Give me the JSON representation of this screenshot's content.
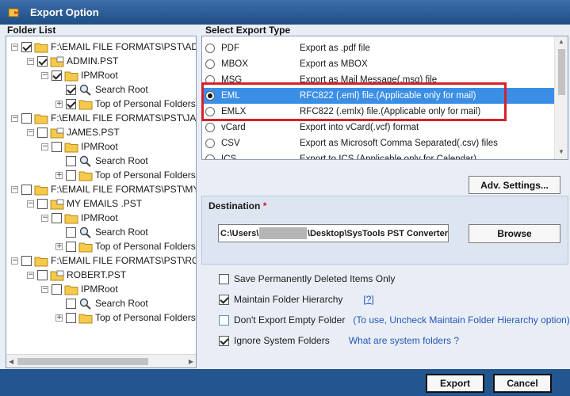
{
  "window": {
    "title": "Export Option"
  },
  "folder_list": {
    "label": "Folder List",
    "nodes": [
      {
        "label": "F:\\EMAIL FILE FORMATS\\PST\\ADM",
        "checked": true,
        "level": 0
      },
      {
        "label": "ADMIN.PST",
        "checked": true,
        "level": 1
      },
      {
        "label": "IPMRoot",
        "checked": true,
        "level": 2
      },
      {
        "label": "Search Root",
        "checked": true,
        "level": 3
      },
      {
        "label": "Top of Personal Folders",
        "checked": true,
        "level": 3
      },
      {
        "label": "F:\\EMAIL FILE FORMATS\\PST\\JAME",
        "checked": false,
        "level": 0
      },
      {
        "label": "JAMES.PST",
        "checked": false,
        "level": 1
      },
      {
        "label": "IPMRoot",
        "checked": false,
        "level": 2
      },
      {
        "label": "Search Root",
        "checked": false,
        "level": 3
      },
      {
        "label": "Top of Personal Folders",
        "checked": false,
        "level": 3
      },
      {
        "label": "F:\\EMAIL FILE FORMATS\\PST\\MY E",
        "checked": false,
        "level": 0
      },
      {
        "label": "MY EMAILS .PST",
        "checked": false,
        "level": 1
      },
      {
        "label": "IPMRoot",
        "checked": false,
        "level": 2
      },
      {
        "label": "Search Root",
        "checked": false,
        "level": 3
      },
      {
        "label": "Top of Personal Folders",
        "checked": false,
        "level": 3
      },
      {
        "label": "F:\\EMAIL FILE FORMATS\\PST\\ROBE",
        "checked": false,
        "level": 0
      },
      {
        "label": "ROBERT.PST",
        "checked": false,
        "level": 1
      },
      {
        "label": "IPMRoot",
        "checked": false,
        "level": 2
      },
      {
        "label": "Search Root",
        "checked": false,
        "level": 3
      },
      {
        "label": "Top of Personal Folders",
        "checked": false,
        "level": 3
      }
    ]
  },
  "export_type": {
    "label": "Select Export Type",
    "selected": "EML",
    "options": [
      {
        "name": "PDF",
        "desc": "Export as .pdf file"
      },
      {
        "name": "MBOX",
        "desc": "Export as MBOX"
      },
      {
        "name": "MSG",
        "desc": "Export as Mail Message(.msg) file"
      },
      {
        "name": "EML",
        "desc": "RFC822 (.eml) file.(Applicable only for mail)"
      },
      {
        "name": "EMLX",
        "desc": "RFC822 (.emlx) file.(Applicable only for mail)"
      },
      {
        "name": "vCard",
        "desc": "Export into vCard(.vcf) format"
      },
      {
        "name": "CSV",
        "desc": "Export as Microsoft Comma Separated(.csv) files"
      },
      {
        "name": "ICS",
        "desc": "Export to ICS (Applicable only for Calendar)"
      }
    ]
  },
  "adv_settings": {
    "label": "Adv. Settings..."
  },
  "destination": {
    "label": "Destination",
    "required_mark": "*",
    "path_prefix": "C:\\Users\\",
    "path_suffix": "\\Desktop\\SysTools PST Converter",
    "browse_label": "Browse"
  },
  "options": {
    "save_deleted": {
      "label": "Save Permanently Deleted Items Only",
      "checked": false
    },
    "maintain_hierarchy": {
      "label": "Maintain Folder Hierarchy",
      "checked": true,
      "help": "[?]"
    },
    "dont_export_empty": {
      "label": "Don't Export Empty Folder",
      "checked": false,
      "note": "(To use, Uncheck Maintain Folder Hierarchy option)"
    },
    "ignore_system": {
      "label": "Ignore System Folders",
      "checked": true,
      "link": "What are system folders ?"
    }
  },
  "footer": {
    "export_label": "Export",
    "cancel_label": "Cancel"
  },
  "colors": {
    "titlebar": "#2a5a95",
    "selection": "#3a8ee6",
    "highlight": "#d4222b",
    "footer": "#23558f",
    "link": "#2457b8"
  },
  "icons": {
    "app": "export-app-icon",
    "folder": "folder-icon",
    "pst": "pst-file-icon",
    "search": "search-folder-icon",
    "expander_minus": "−",
    "expander_plus": "+"
  }
}
